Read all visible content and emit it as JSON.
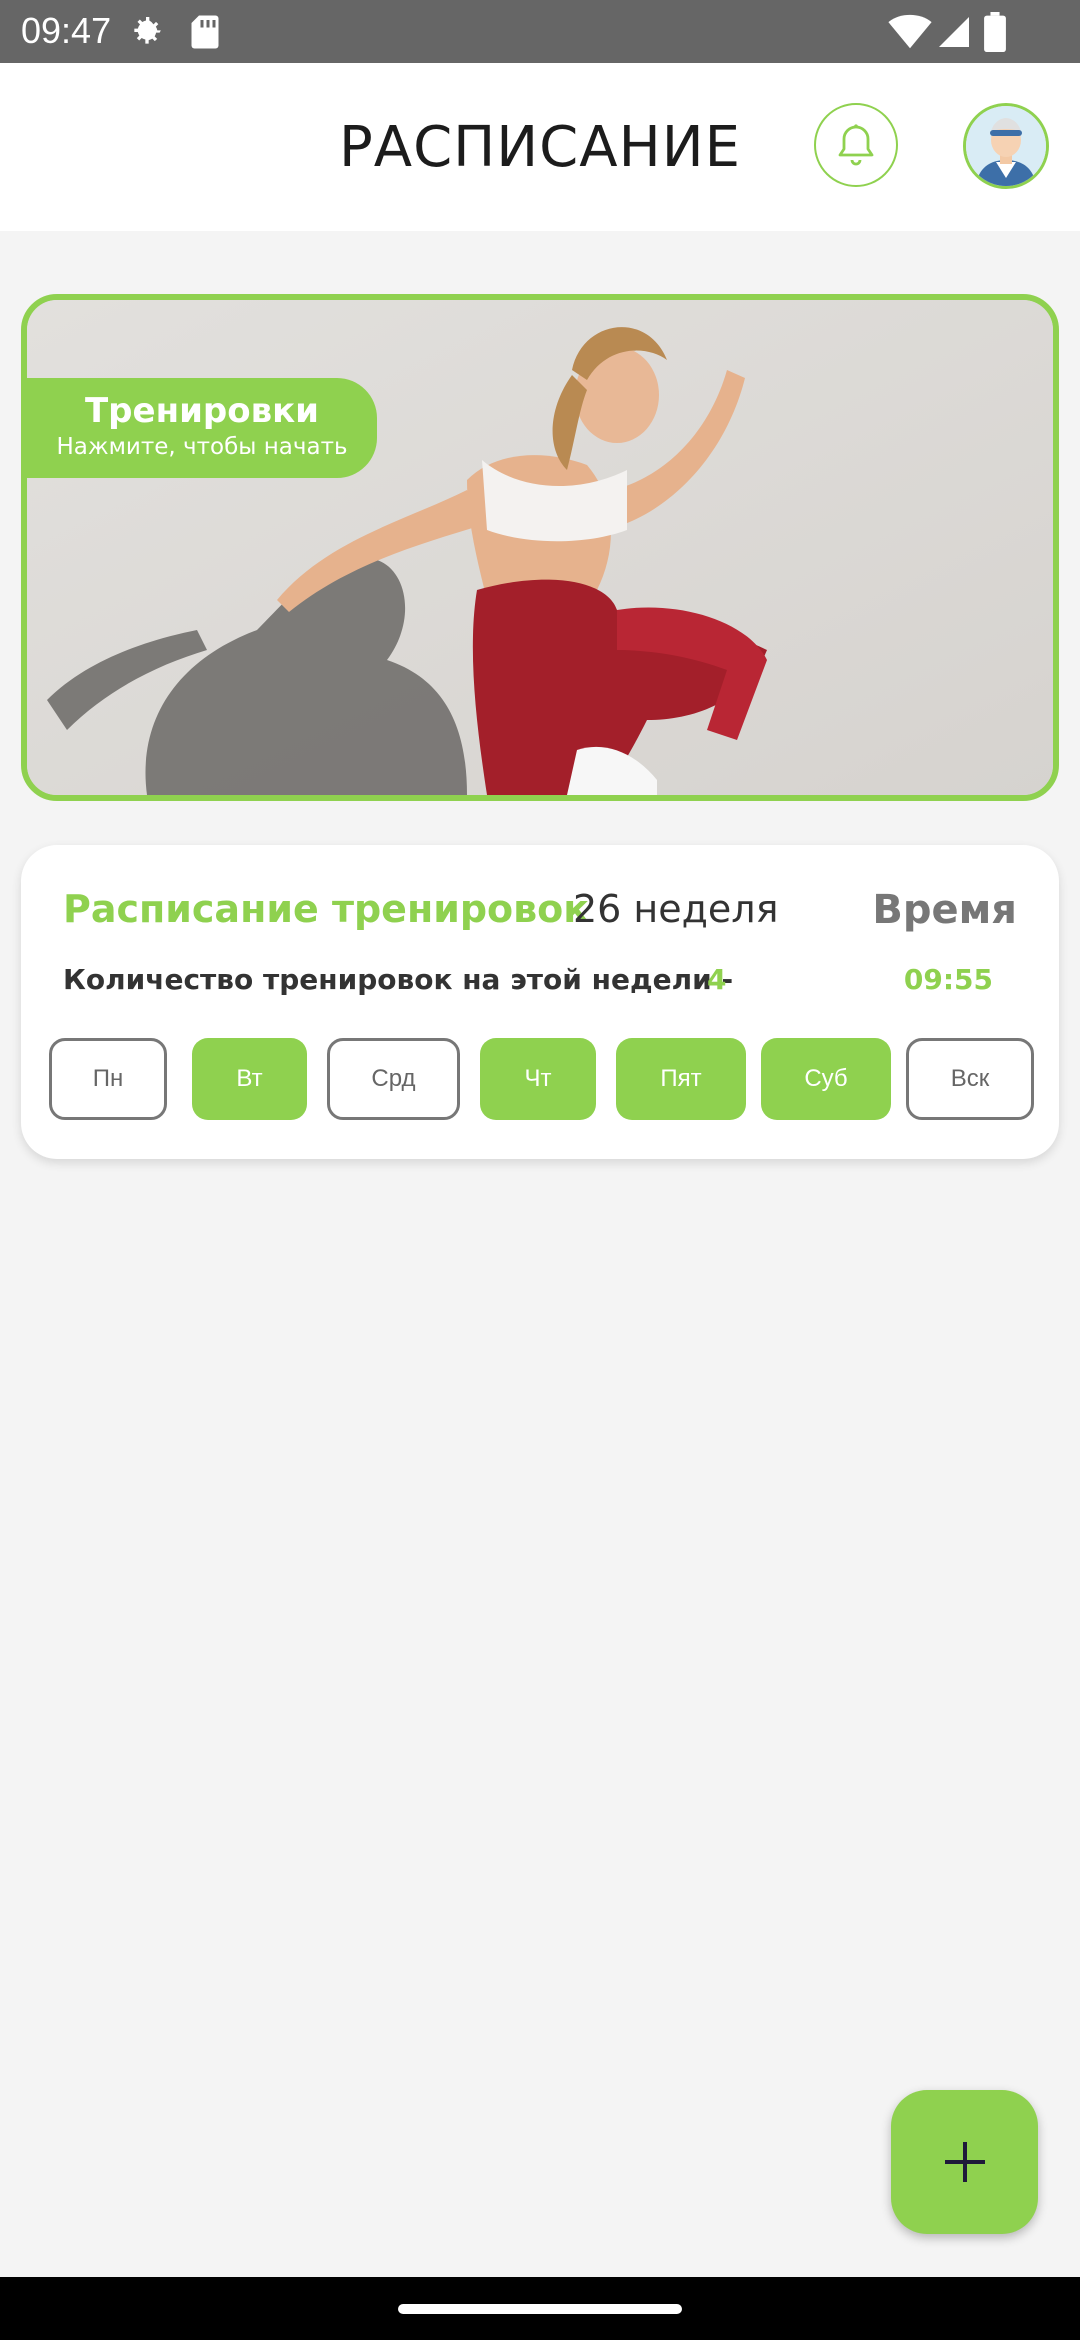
{
  "status_bar": {
    "time": "09:47",
    "icons": [
      "gear-icon",
      "sd-card-icon",
      "wifi-icon",
      "signal-icon",
      "battery-icon"
    ]
  },
  "header": {
    "title": "РАСПИСАНИЕ",
    "icons": [
      "bell-icon",
      "avatar"
    ]
  },
  "banner": {
    "title": "Тренировки",
    "subtitle": "Нажмите, чтобы начать"
  },
  "schedule": {
    "title": "Расписание тренировок",
    "week": "26 неделя",
    "time_label": "Время",
    "count_label": "Количество тренировок на этой недели -",
    "count_value": "4",
    "time_value": "09:55",
    "days": [
      {
        "label": "Пн",
        "active": false
      },
      {
        "label": "Вт",
        "active": true
      },
      {
        "label": "Срд",
        "active": false
      },
      {
        "label": "Чт",
        "active": true
      },
      {
        "label": "Пят",
        "active": true
      },
      {
        "label": "Суб",
        "active": true
      },
      {
        "label": "Вск",
        "active": false
      }
    ]
  },
  "fab": {
    "icon": "plus-icon"
  },
  "colors": {
    "accent": "#8fd14f",
    "status_bar": "#666666",
    "background": "#f4f4f4",
    "nav_bar": "#000000"
  }
}
